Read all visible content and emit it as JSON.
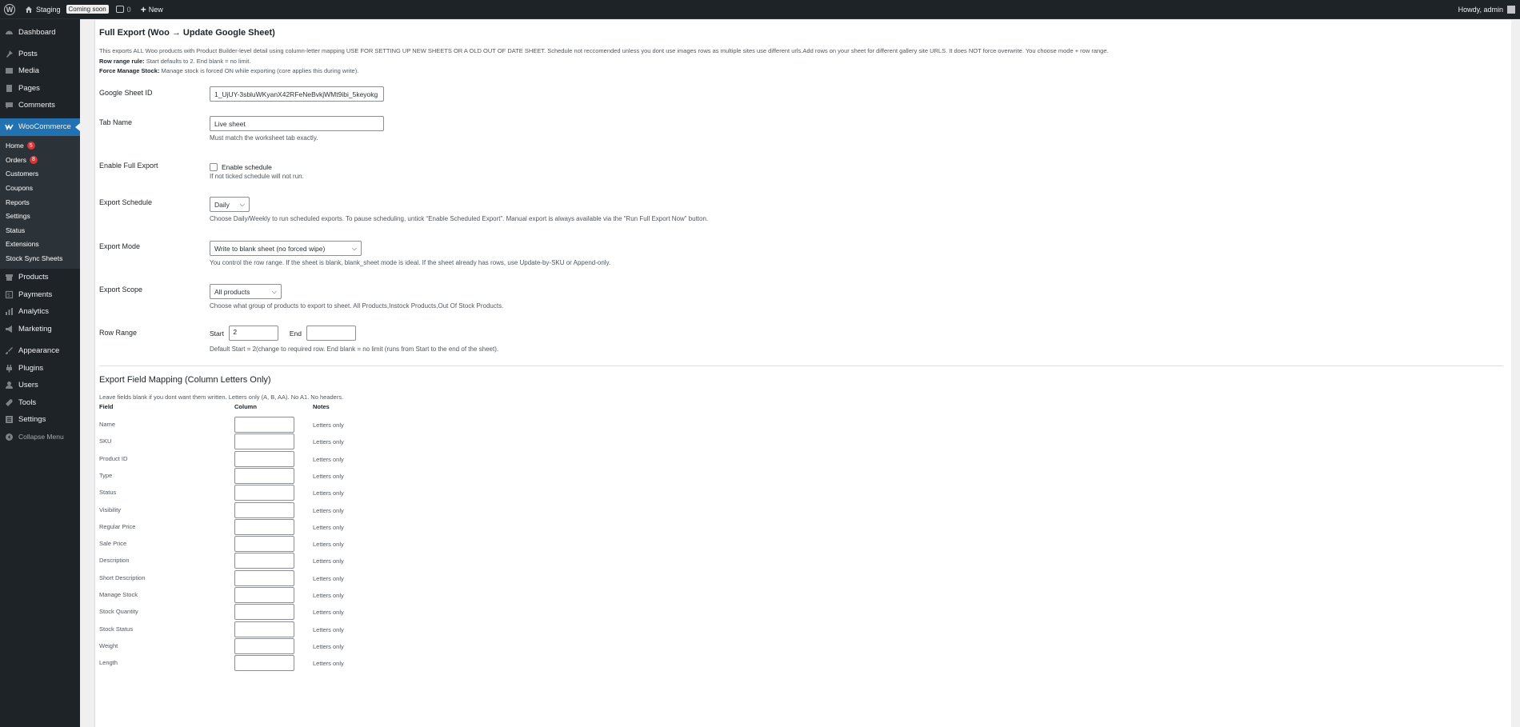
{
  "adminbar": {
    "wp_logo": "W",
    "site_name": "Staging",
    "coming_soon": "Coming soon",
    "comments_count": "0",
    "new_label": "New",
    "howdy": "Howdy, admin"
  },
  "sidebar": {
    "dashboard": "Dashboard",
    "posts": "Posts",
    "media": "Media",
    "pages": "Pages",
    "comments": "Comments",
    "woocommerce": "WooCommerce",
    "woo_sub": [
      {
        "label": "Home",
        "badge": "5"
      },
      {
        "label": "Orders",
        "badge": "8"
      },
      {
        "label": "Customers"
      },
      {
        "label": "Coupons"
      },
      {
        "label": "Reports"
      },
      {
        "label": "Settings"
      },
      {
        "label": "Status"
      },
      {
        "label": "Extensions"
      },
      {
        "label": "Stock Sync Sheets"
      }
    ],
    "products": "Products",
    "payments": "Payments",
    "analytics": "Analytics",
    "marketing": "Marketing",
    "appearance": "Appearance",
    "plugins": "Plugins",
    "users": "Users",
    "tools": "Tools",
    "settings": "Settings",
    "collapse": "Collapse Menu"
  },
  "page": {
    "title": "Full Export (Woo → Update Google Sheet)",
    "intro_line1": "This exports ALL Woo products with Product Builder-level detail using column-letter mapping USE FOR SETTING UP NEW SHEETS OR A OLD OUT OF DATE SHEET. Schedule not reccomended unless you dont use images rows as multiple sites use different urls.Add rows on your sheet for different gallery site URLS. It does NOT force overwrite. You choose mode + row range.",
    "intro_line2_label": "Row range rule:",
    "intro_line2_text": " Start defaults to 2. End blank = no limit.",
    "intro_line3_label": "Force Manage Stock:",
    "intro_line3_text": " Manage stock is forced ON while exporting (core applies this during write).",
    "sheet_id_label": "Google Sheet ID",
    "sheet_id_value": "1_UjUY-3sbluWKyanX42RFeNeBvkjWMt9ibi_5keyokg",
    "tab_name_label": "Tab Name",
    "tab_name_value": "Live sheet",
    "tab_name_desc": "Must match the worksheet tab exactly.",
    "enable_label": "Enable Full Export",
    "enable_cb_label": "Enable schedule",
    "enable_desc": "If not ticked schedule will not run.",
    "schedule_label": "Export Schedule",
    "schedule_value": "Daily",
    "schedule_desc": "Choose Daily/Weekly to run scheduled exports. To pause scheduling, untick “Enable Scheduled Export”. Manual export is always available via the “Run Full Export Now” button.",
    "mode_label": "Export Mode",
    "mode_value": "Write to blank sheet (no forced wipe)",
    "mode_desc": "You control the row range. If the sheet is blank, blank_sheet mode is ideal. If the sheet already has rows, use Update-by-SKU or Append-only.",
    "scope_label": "Export Scope",
    "scope_value": "All products",
    "scope_desc": "Choose what group of products to export to sheet. All Products,Instock Products,Out Of Stock Products.",
    "range_label": "Row Range",
    "range_start_label": "Start",
    "range_start_value": "2",
    "range_end_label": "End",
    "range_end_value": "",
    "range_desc": "Default Start = 2(change to required row. End blank = no limit (runs from Start to the end of the sheet).",
    "mapping_title": "Export Field Mapping (Column Letters Only)",
    "mapping_sub": "Leave fields blank if you dont want them written. Letters only (A, B, AA). No A1. No headers.",
    "col_field": "Field",
    "col_column": "Column",
    "col_notes": "Notes",
    "fields": [
      {
        "name": "Name",
        "note": "Letters only"
      },
      {
        "name": "SKU",
        "note": "Letters only"
      },
      {
        "name": "Product ID",
        "note": "Letters only"
      },
      {
        "name": "Type",
        "note": "Letters only"
      },
      {
        "name": "Status",
        "note": "Letters only"
      },
      {
        "name": "Visibility",
        "note": "Letters only"
      },
      {
        "name": "Regular Price",
        "note": "Letters only"
      },
      {
        "name": "Sale Price",
        "note": "Letters only"
      },
      {
        "name": "Description",
        "note": "Letters only"
      },
      {
        "name": "Short Description",
        "note": "Letters only"
      },
      {
        "name": "Manage Stock",
        "note": "Letters only"
      },
      {
        "name": "Stock Quantity",
        "note": "Letters only"
      },
      {
        "name": "Stock Status",
        "note": "Letters only"
      },
      {
        "name": "Weight",
        "note": "Letters only"
      },
      {
        "name": "Length",
        "note": "Letters only"
      }
    ]
  }
}
